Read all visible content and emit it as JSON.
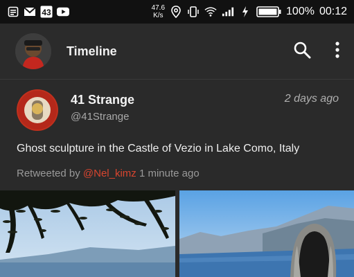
{
  "status_bar": {
    "net_speed_value": "47.6",
    "net_speed_unit": "K/s",
    "battery": "100%",
    "time": "00:12",
    "icons_left": [
      "notes-icon",
      "gmail-icon",
      "app-icon-43",
      "youtube-icon"
    ],
    "icons_right": [
      "location-icon",
      "vibrate-icon",
      "wifi-icon",
      "signal-icon",
      "charging-icon",
      "battery-icon"
    ]
  },
  "app_bar": {
    "title": "Timeline",
    "actions": [
      "search-icon",
      "more-vert-icon"
    ]
  },
  "tweet": {
    "name": "41 Strange",
    "handle": "@41Strange",
    "time": "2 days ago",
    "text": "Ghost sculpture in the Castle of Vezio in Lake Como, Italy",
    "retweet_prefix": "Retweeted by ",
    "retweet_user": "@Nel_kimz",
    "retweet_suffix": " 1 minute ago"
  },
  "colors": {
    "background": "#2a2a2a",
    "status_bar": "#111111",
    "app_bar": "#2b2b2b",
    "retweet_accent": "#d8452f"
  }
}
